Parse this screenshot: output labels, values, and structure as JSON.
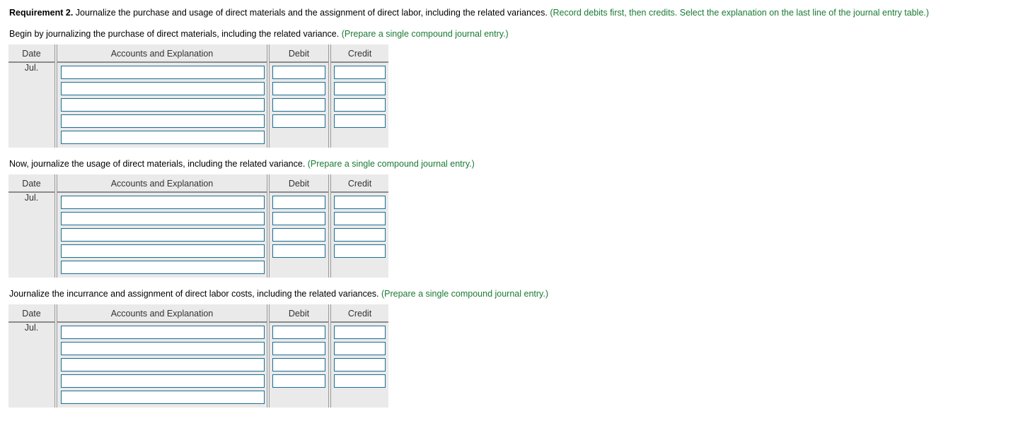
{
  "requirement": {
    "label": "Requirement 2.",
    "text": " Journalize the purchase and usage of direct materials and the assignment of direct labor, including the related variances. ",
    "hint": "(Record debits first, then credits. Select the explanation on the last line of the journal entry table.)"
  },
  "sections": [
    {
      "id": "purchase-direct-materials",
      "text": "Begin by journalizing the purchase of direct materials, including the related variance. ",
      "hint": "(Prepare a single compound journal entry.)",
      "table": {
        "headers": {
          "date": "Date",
          "accounts": "Accounts and Explanation",
          "debit": "Debit",
          "credit": "Credit"
        },
        "date_value": "Jul.",
        "rows": [
          {
            "accounts": "",
            "debit": "",
            "credit": "",
            "has_amounts": true
          },
          {
            "accounts": "",
            "debit": "",
            "credit": "",
            "has_amounts": true
          },
          {
            "accounts": "",
            "debit": "",
            "credit": "",
            "has_amounts": true
          },
          {
            "accounts": "",
            "debit": "",
            "credit": "",
            "has_amounts": true
          },
          {
            "accounts": "",
            "debit": "",
            "credit": "",
            "has_amounts": false
          }
        ]
      }
    },
    {
      "id": "usage-direct-materials",
      "text": "Now, journalize the usage of direct materials, including the related variance. ",
      "hint": "(Prepare a single compound journal entry.)",
      "table": {
        "headers": {
          "date": "Date",
          "accounts": "Accounts and Explanation",
          "debit": "Debit",
          "credit": "Credit"
        },
        "date_value": "Jul.",
        "rows": [
          {
            "accounts": "",
            "debit": "",
            "credit": "",
            "has_amounts": true
          },
          {
            "accounts": "",
            "debit": "",
            "credit": "",
            "has_amounts": true
          },
          {
            "accounts": "",
            "debit": "",
            "credit": "",
            "has_amounts": true
          },
          {
            "accounts": "",
            "debit": "",
            "credit": "",
            "has_amounts": true
          },
          {
            "accounts": "",
            "debit": "",
            "credit": "",
            "has_amounts": false
          }
        ]
      }
    },
    {
      "id": "direct-labor-costs",
      "text": "Journalize the incurrance and assignment of direct labor costs, including the related variances. ",
      "hint": "(Prepare a single compound journal entry.)",
      "table": {
        "headers": {
          "date": "Date",
          "accounts": "Accounts and Explanation",
          "debit": "Debit",
          "credit": "Credit"
        },
        "date_value": "Jul.",
        "rows": [
          {
            "accounts": "",
            "debit": "",
            "credit": "",
            "has_amounts": true
          },
          {
            "accounts": "",
            "debit": "",
            "credit": "",
            "has_amounts": true
          },
          {
            "accounts": "",
            "debit": "",
            "credit": "",
            "has_amounts": true
          },
          {
            "accounts": "",
            "debit": "",
            "credit": "",
            "has_amounts": true
          },
          {
            "accounts": "",
            "debit": "",
            "credit": "",
            "has_amounts": false
          }
        ]
      }
    }
  ],
  "colors": {
    "hint_green": "#1a7a33",
    "field_border": "#1a6e96",
    "table_bg": "#eaeaea",
    "grid_line": "#8c8c8c"
  }
}
